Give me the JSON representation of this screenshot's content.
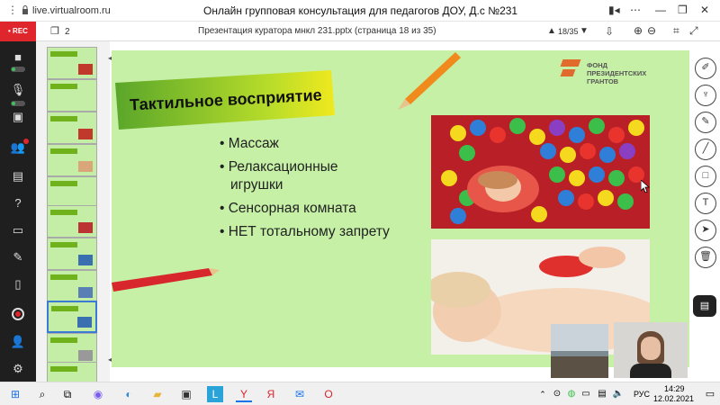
{
  "browser": {
    "url": "live.virtualroom.ru",
    "window_title": "Онлайн групповая консультация для педагогов ДОУ, Д.с №231"
  },
  "app_bar": {
    "rec_label": "• REC"
  },
  "viewer": {
    "thumb_count": "2",
    "file_title": "Презентация куратора мнкл 231.pptx (страница 18 из 35)",
    "page_indicator": "18/35"
  },
  "slide": {
    "heading": "Тактильное восприятие",
    "bullets": [
      "Массаж",
      "Релаксационные игрушки",
      "Сенсорная комната",
      "НЕТ тотальному запрету"
    ],
    "logo_text_line1": "ФОНД",
    "logo_text_line2": "ПРЕЗИДЕНТСКИХ",
    "logo_text_line3": "ГРАНТОВ"
  },
  "taskbar": {
    "lang": "РУС",
    "time": "14:29",
    "date": "12.02.2021"
  },
  "colors": {
    "slide_bg": "#c5f0a5",
    "heading_bar": "#76c02c",
    "rec_red": "#e0262d"
  }
}
